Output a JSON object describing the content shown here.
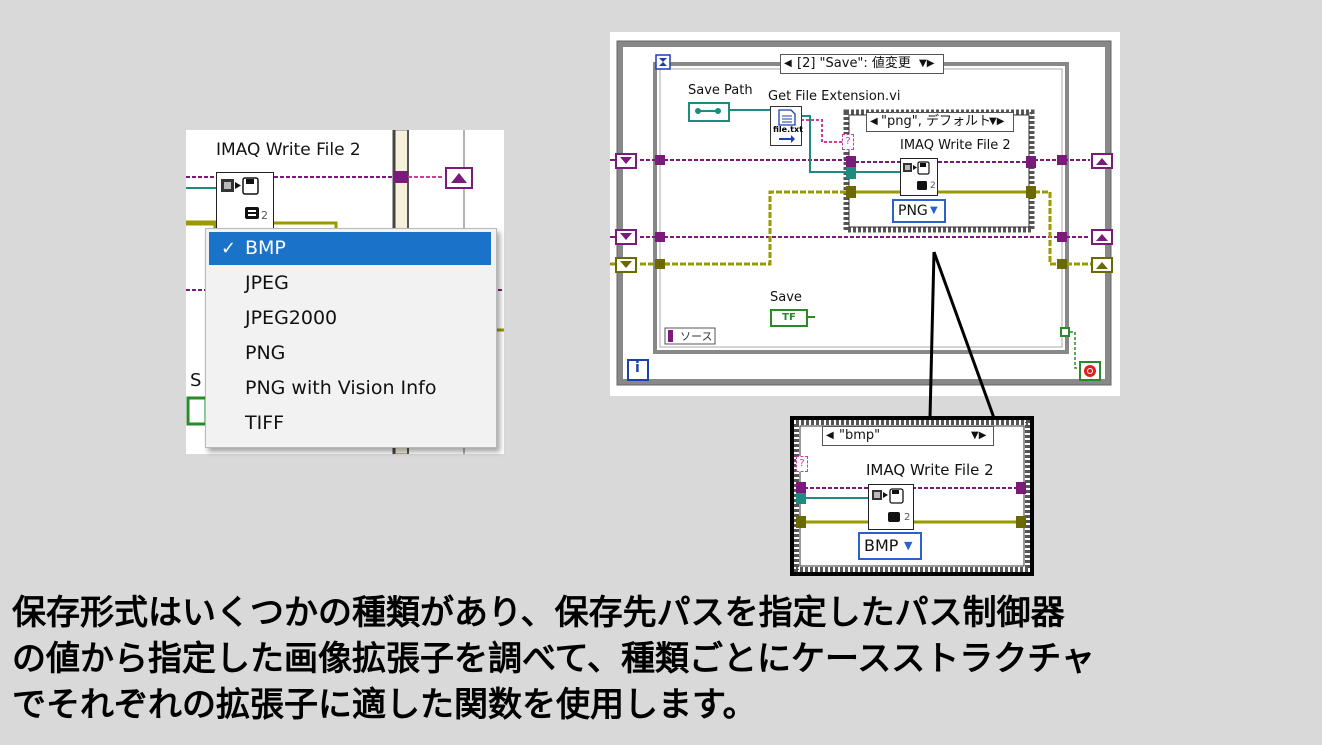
{
  "left_panel": {
    "node_label": "IMAQ Write File 2",
    "node_small_number": "2",
    "menu_items": [
      {
        "label": "BMP",
        "selected": true
      },
      {
        "label": "JPEG",
        "selected": false
      },
      {
        "label": "JPEG2000",
        "selected": false
      },
      {
        "label": "PNG",
        "selected": false
      },
      {
        "label": "PNG with Vision Info",
        "selected": false
      },
      {
        "label": "TIFF",
        "selected": false
      }
    ],
    "checkmark": "✓",
    "partial_label": "S"
  },
  "right_panel": {
    "event_selector": "[2] \"Save\": 値変更",
    "save_path_label": "Save Path",
    "get_ext_label": "Get File Extension.vi",
    "file_icon_text": "file.txt",
    "case_selector": "\"png\", デフォルト",
    "node_label": "IMAQ Write File 2",
    "node_small_number": "2",
    "format_value": "PNG",
    "save_label": "Save",
    "save_button_text": "TF",
    "source_label": "ソース",
    "iteration_label": "i",
    "question_mark": "?"
  },
  "inset": {
    "case_selector": "\"bmp\"",
    "node_label": "IMAQ Write File 2",
    "node_small_number": "2",
    "format_value": "BMP",
    "question_mark": "?"
  },
  "caption": {
    "lines": [
      "保存形式はいくつかの種類があり、保存先パスを指定したパス制御器",
      "の値から指定した画像拡張子を調べて、種類ごとにケースストラクチャ",
      "でそれぞれの拡張子に適した関数を使用します。"
    ]
  },
  "colors": {
    "wire_pink": "#cc3d9e",
    "wire_purple": "#7a1a7a",
    "wire_teal": "#1f8a80",
    "wire_olive": "#9a9a00",
    "enum_blue": "#2c5fd0",
    "menu_highlight": "#1a73c8",
    "stop_red": "#e02020",
    "background": "#d9d9d9"
  }
}
